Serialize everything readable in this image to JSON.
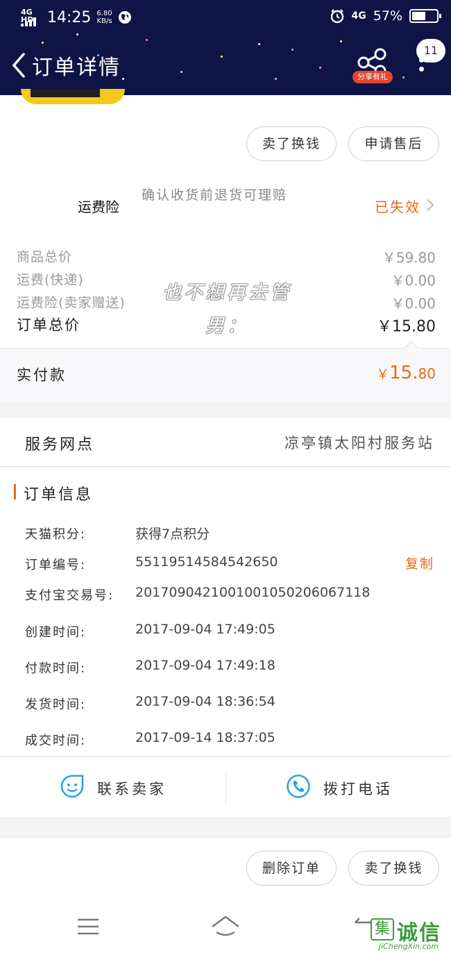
{
  "status_bar": {
    "network": "4G HD",
    "time": "14:25",
    "speed_value": "6.80",
    "speed_unit": "KB/s",
    "signal_right": "4G",
    "battery": "57%",
    "battery_level": 0.57
  },
  "header": {
    "title": "订单详情",
    "share_label": "分享有礼",
    "badge_count": "11"
  },
  "actions_top": {
    "sell_label": "卖了换钱",
    "after_sale_label": "申请售后"
  },
  "insurance": {
    "label": "运费险",
    "description": "确认收货前退货可理赔",
    "status": "已失效"
  },
  "prices": [
    {
      "label": "商品总价",
      "value": "￥59.80"
    },
    {
      "label": "运费(快递)",
      "value": "￥0.00"
    },
    {
      "label": "运费险(卖家赠送)",
      "value": "￥0.00"
    }
  ],
  "order_total": {
    "label": "订单总价",
    "value": "￥15.80"
  },
  "paid": {
    "label": "实付款",
    "currency": "￥",
    "integer": "15.",
    "decimal": "80"
  },
  "overlay_text": {
    "line1": "也不想再去管",
    "line2": "男："
  },
  "service": {
    "label": "服务网点",
    "value": "凉亭镇太阳村服务站"
  },
  "order_info": {
    "title": "订单信息",
    "copy_label": "复制",
    "rows": [
      {
        "key": "天猫积分:",
        "value": "获得7点积分"
      },
      {
        "key": "订单编号:",
        "value": "55119514584542650"
      },
      {
        "key": "支付宝交易号:",
        "value": "2017090421001001050206067118"
      },
      {
        "key": "创建时间:",
        "value": "2017-09-04 17:49:05"
      },
      {
        "key": "付款时间:",
        "value": "2017-09-04 17:49:18"
      },
      {
        "key": "发货时间:",
        "value": "2017-09-04 18:36:54"
      },
      {
        "key": "成交时间:",
        "value": "2017-09-14 18:37:05"
      }
    ]
  },
  "contact": {
    "seller_label": "联系卖家",
    "call_label": "拨打电话"
  },
  "actions_bottom": {
    "delete_label": "删除订单",
    "sell_label": "卖了换钱"
  },
  "watermark": {
    "box_char": "集",
    "text": "诚信",
    "url": "JiChengXin.com"
  },
  "colors": {
    "header_bg": "#0f1446",
    "accent": "#e66a17",
    "icon_blue": "#2aa7dc"
  }
}
